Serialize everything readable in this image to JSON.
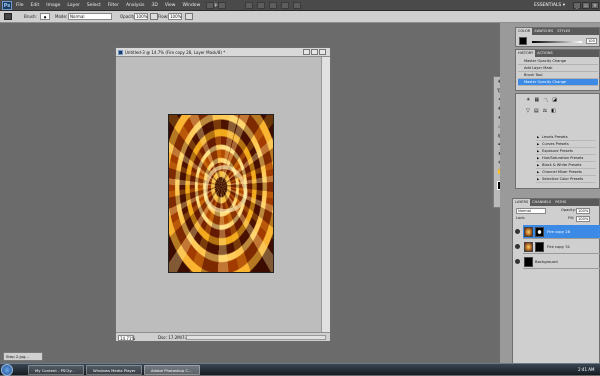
{
  "menubar": {
    "items": [
      "File",
      "Edit",
      "Image",
      "Layer",
      "Select",
      "Filter",
      "Analysis",
      "3D",
      "View",
      "Window",
      "Help"
    ],
    "workspace": "ESSENTIALS ▾"
  },
  "options": {
    "brush_label": "Brush:",
    "mode_label": "Mode:",
    "mode_value": "Normal",
    "opacity_label": "Opacity:",
    "opacity_value": "100%",
    "flow_label": "Flow:",
    "flow_value": "100%"
  },
  "document": {
    "title": "Untitled-3 @ 14.7% (Fire copy 28, Layer Mask/8) *",
    "zoom": "14.71%",
    "doc_size": "Doc: 17.2M/73.6M"
  },
  "color_panel": {
    "tabs": [
      "COLOR",
      "SWATCHES",
      "STYLES"
    ],
    "value": "100"
  },
  "history_panel": {
    "tabs": [
      "HISTORY",
      "ACTIONS"
    ],
    "items": [
      "Master Opacity Change",
      "Add Layer Mask",
      "Brush Tool",
      "Master Opacity Change"
    ]
  },
  "adjustments_panel": {
    "presets": [
      "Levels Presets",
      "Curves Presets",
      "Exposure Presets",
      "Hue/Saturation Presets",
      "Black & White Presets",
      "Channel Mixer Presets",
      "Selective Color Presets"
    ]
  },
  "layers_panel": {
    "tabs": [
      "LAYERS",
      "CHANNELS",
      "PATHS"
    ],
    "blend": "Normal",
    "opacity_label": "Opacity:",
    "opacity": "100%",
    "fill_label": "Fill:",
    "fill": "100%",
    "lock_label": "Lock:",
    "layers": [
      "Fire copy 28",
      "Fire copy 31",
      "Background"
    ]
  },
  "minimized": {
    "label": "Step 2.jpg..."
  },
  "taskbar": {
    "tasks": [
      "My Content - PSCty...",
      "Windows Media Player",
      "Adobe Photoshop C..."
    ],
    "clock": "2:41 AM"
  }
}
